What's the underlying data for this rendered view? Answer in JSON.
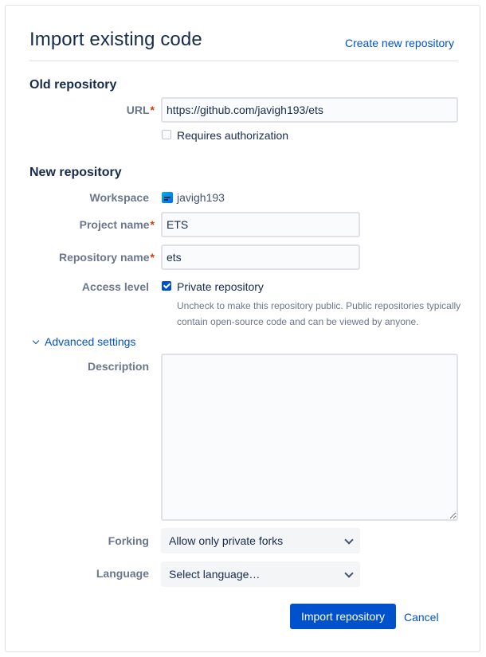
{
  "header": {
    "title": "Import existing code",
    "create_link": "Create new repository"
  },
  "old_repo": {
    "heading": "Old repository",
    "url_label": "URL",
    "url_value": "https://github.com/javigh193/ets",
    "requires_auth_label": "Requires authorization",
    "requires_auth_checked": false
  },
  "new_repo": {
    "heading": "New repository",
    "workspace_label": "Workspace",
    "workspace_value": "javigh193",
    "project_label": "Project name",
    "project_value": "ETS",
    "repo_name_label": "Repository name",
    "repo_name_value": "ets",
    "access_label": "Access level",
    "private_label": "Private repository",
    "private_checked": true,
    "private_help": "Uncheck to make this repository public. Public repositories typically contain open-source code and can be viewed by anyone."
  },
  "advanced": {
    "toggle_label": "Advanced settings",
    "description_label": "Description",
    "description_value": "",
    "forking_label": "Forking",
    "forking_value": "Allow only private forks",
    "language_label": "Language",
    "language_value": "Select language…"
  },
  "actions": {
    "import_label": "Import repository",
    "cancel_label": "Cancel"
  },
  "colors": {
    "primary": "#0052cc",
    "required": "#de350b",
    "label": "#6b778c",
    "text": "#172b4d"
  }
}
